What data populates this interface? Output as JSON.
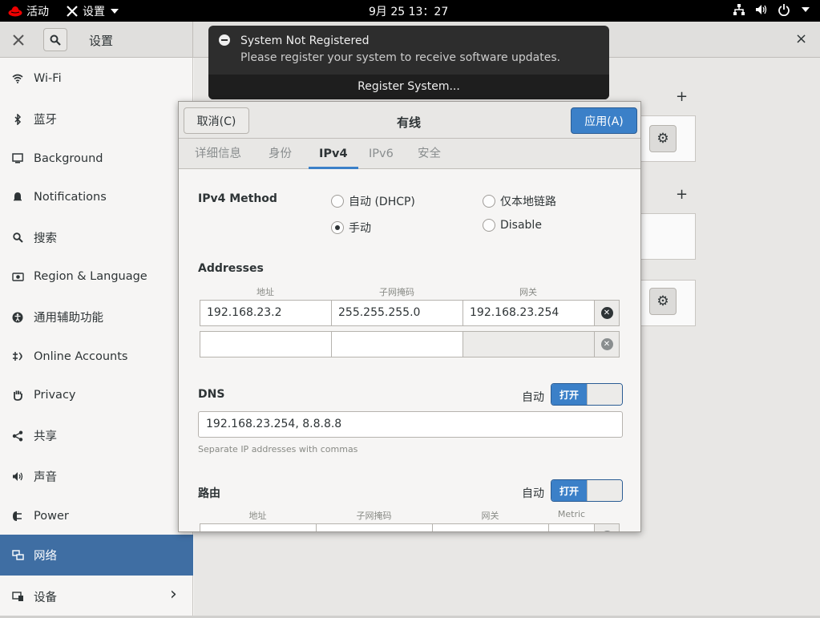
{
  "topbar": {
    "activities": "活动",
    "app_menu": "设置",
    "clock": "9月 25  13：27"
  },
  "window": {
    "sidebar_title": "设置",
    "close_glyph": "×"
  },
  "sidebar": {
    "items": [
      {
        "label": "Wi-Fi",
        "icon": "wifi-icon"
      },
      {
        "label": "蓝牙",
        "icon": "bluetooth-icon"
      },
      {
        "label": "Background",
        "icon": "monitor-icon"
      },
      {
        "label": "Notifications",
        "icon": "bell-icon"
      },
      {
        "label": "搜索",
        "icon": "search-icon"
      },
      {
        "label": "Region & Language",
        "icon": "camera-icon"
      },
      {
        "label": "通用辅助功能",
        "icon": "accessibility-icon"
      },
      {
        "label": "Online Accounts",
        "icon": "online-accounts-icon"
      },
      {
        "label": "Privacy",
        "icon": "hand-icon"
      },
      {
        "label": "共享",
        "icon": "share-icon"
      },
      {
        "label": "声音",
        "icon": "speaker-icon"
      },
      {
        "label": "Power",
        "icon": "power-plug-icon"
      },
      {
        "label": "网络",
        "icon": "network-icon",
        "selected": true
      },
      {
        "label": "设备",
        "icon": "devices-icon",
        "chevron": "›"
      }
    ]
  },
  "notification": {
    "title": "System Not Registered",
    "body": "Please register your system to receive software updates.",
    "action": "Register System..."
  },
  "dialog": {
    "title": "有线",
    "cancel": "取消(C)",
    "apply": "应用(A)",
    "tabs": [
      "详细信息",
      "身份",
      "IPv4",
      "IPv6",
      "安全"
    ],
    "active_tab": "IPv4",
    "ipv4_method_label": "IPv4 Method",
    "methods": {
      "auto_dhcp": "自动 (DHCP)",
      "link_local": "仅本地链路",
      "manual": "手动",
      "disable": "Disable",
      "selected": "手动"
    },
    "addresses_label": "Addresses",
    "address_headers": [
      "地址",
      "子网掩码",
      "网关"
    ],
    "addresses": [
      {
        "address": "192.168.23.2",
        "netmask": "255.255.255.0",
        "gateway": "192.168.23.254"
      },
      {
        "address": "",
        "netmask": "",
        "gateway": ""
      }
    ],
    "dns_label": "DNS",
    "auto_label": "自动",
    "switch_on": "打开",
    "dns_value": "192.168.23.254, 8.8.8.8",
    "dns_hint": "Separate IP addresses with commas",
    "routes_label": "路由",
    "route_headers": [
      "地址",
      "子网掩码",
      "网关",
      "Metric"
    ]
  }
}
